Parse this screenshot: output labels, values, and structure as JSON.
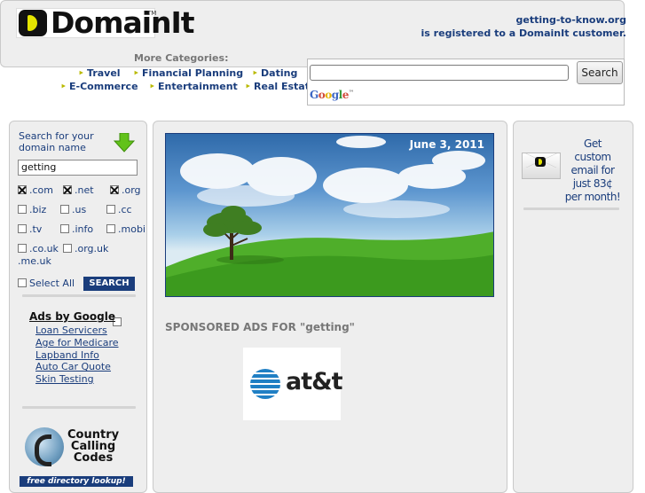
{
  "header": {
    "logo_text": "DomainIt",
    "logo_tm": "TM",
    "domain": "getting-to-know.org",
    "registered_text": "is registered to a DomainIt customer."
  },
  "categories": {
    "title": "More Categories:",
    "items": [
      "Travel",
      "Financial Planning",
      "Dating",
      "E-Commerce",
      "Entertainment",
      "Real Estate"
    ]
  },
  "google_search": {
    "button_label": "Search",
    "input_value": "",
    "logo_text": "Google"
  },
  "domain_search": {
    "title_line1": "Search for your",
    "title_line2": "domain name",
    "input_value": "getting",
    "tlds": [
      {
        "label": ".com",
        "checked": true
      },
      {
        "label": ".net",
        "checked": true
      },
      {
        "label": ".org",
        "checked": true
      },
      {
        "label": ".biz",
        "checked": false
      },
      {
        "label": ".us",
        "checked": false
      },
      {
        "label": ".cc",
        "checked": false
      },
      {
        "label": ".tv",
        "checked": false
      },
      {
        "label": ".info",
        "checked": false
      },
      {
        "label": ".mobi",
        "checked": false
      },
      {
        "label": ".co.uk",
        "checked": false
      },
      {
        "label": ".org.uk",
        "checked": false
      },
      {
        "label": ".me.uk",
        "checked": false
      }
    ],
    "select_all_label": "Select All",
    "search_button_label": "SEARCH"
  },
  "ads": {
    "title": "Ads by Google",
    "links": [
      "Loan Servicers",
      "Age for Medicare",
      "Lapband Info",
      "Auto Car Quote",
      "Skin Testing"
    ]
  },
  "country_codes": {
    "line1": "Country",
    "line2": "Calling",
    "line3": "Codes",
    "banner": "free directory lookup!"
  },
  "hero": {
    "date": "June 3, 2011"
  },
  "sponsored": {
    "text": "SPONSORED ADS FOR \"getting\"",
    "advertiser": "at&t"
  },
  "email_promo": {
    "line1": "Get custom",
    "line2": "email for",
    "line3": "just 83¢",
    "line4": "per month!"
  },
  "colors": {
    "link_blue": "#1a3d7c",
    "panel_bg": "#eeeeee",
    "bullet_yellow": "#b9b900"
  }
}
